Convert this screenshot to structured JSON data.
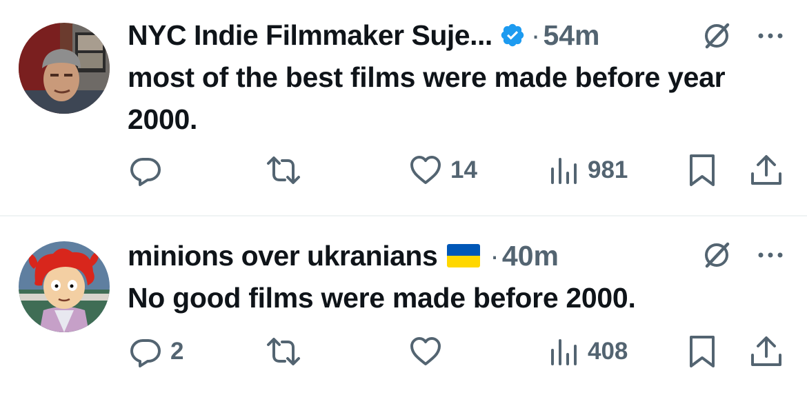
{
  "tweets": [
    {
      "author": "NYC Indie Filmmaker Suje...",
      "verified": true,
      "separator": "·",
      "time": "54m",
      "text": "most of the best films were made before year 2000.",
      "replies": "",
      "reposts": "",
      "likes": "14",
      "views": "981",
      "avatar_icon": "person-photo-avatar"
    },
    {
      "author": "minions over ukranians",
      "flag": "ukraine-flag",
      "separator": "·",
      "time": "40m",
      "text": "No good films were made before 2000.",
      "replies": "2",
      "reposts": "",
      "likes": "",
      "views": "408",
      "avatar_icon": "cartoon-avatar"
    }
  ],
  "icons": {
    "reply": "reply-icon",
    "repost": "repost-icon",
    "like": "heart-icon",
    "views": "views-icon",
    "bookmark": "bookmark-icon",
    "share": "share-icon",
    "grok": "grok-icon",
    "more": "more-icon",
    "verified": "verified-badge-icon"
  },
  "colors": {
    "text": "#0f1419",
    "secondary": "#536471",
    "verified": "#1d9bf0",
    "divider": "#eff3f4",
    "flag_blue": "#0057b7",
    "flag_yellow": "#ffd700"
  }
}
